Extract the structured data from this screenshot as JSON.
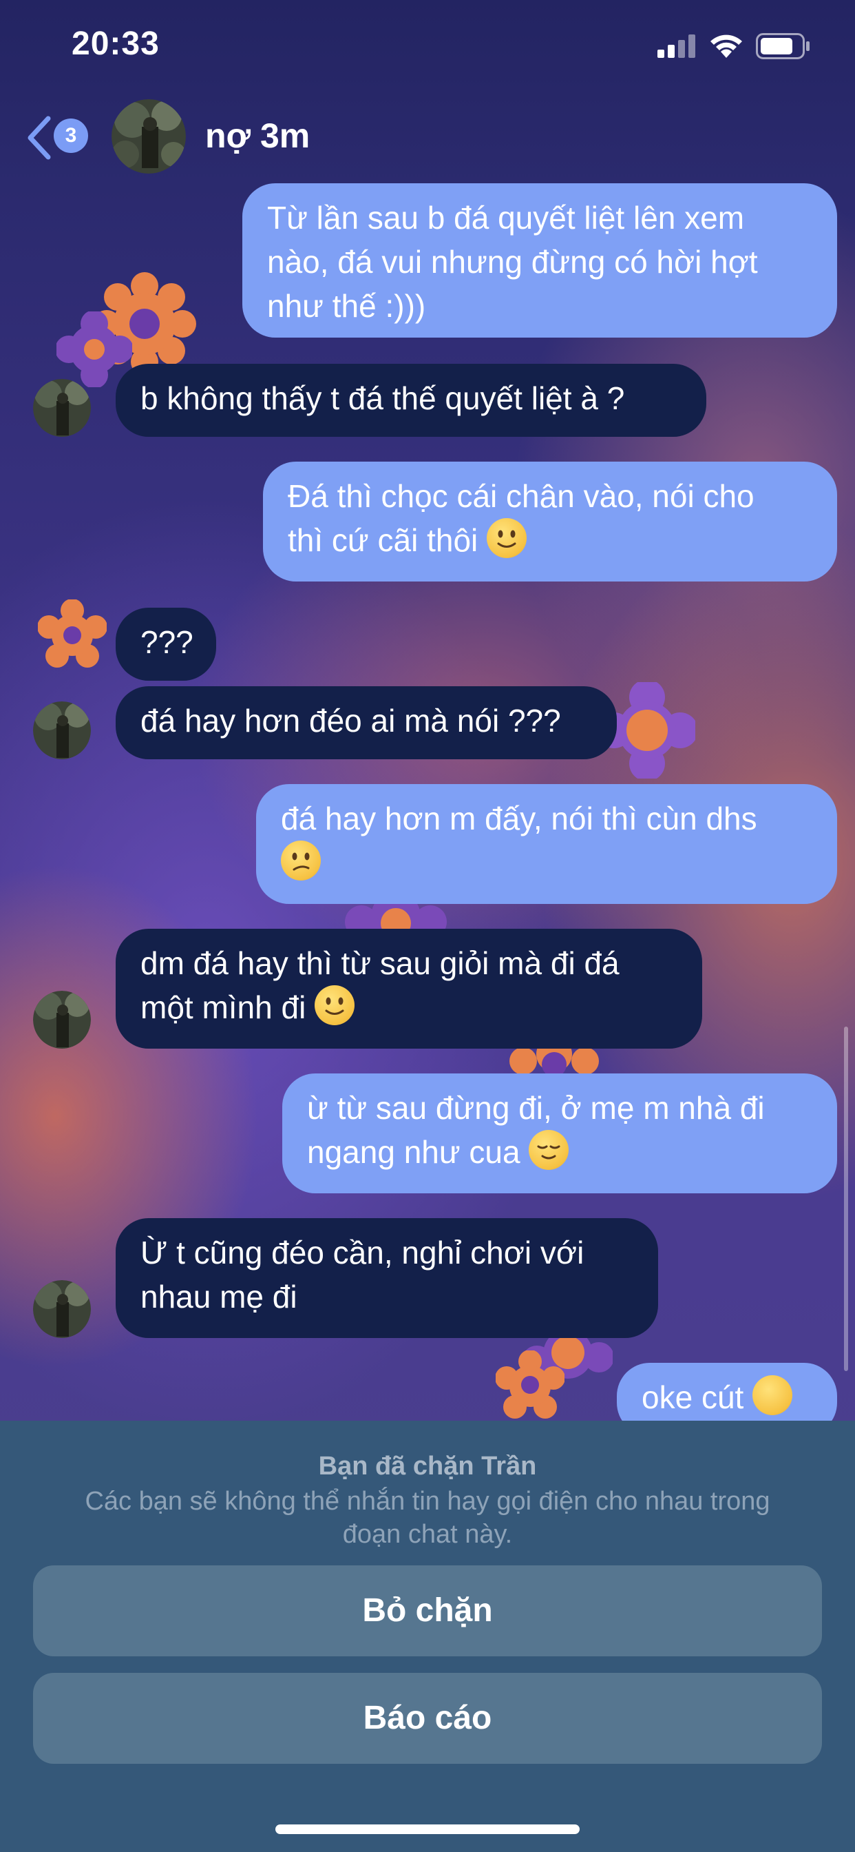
{
  "status_bar": {
    "time": "20:33"
  },
  "header": {
    "back_count": "3",
    "contact_name": "nợ 3m"
  },
  "messages": [
    {
      "id": "m1",
      "side": "sent",
      "lines": [
        "Từ lần sau b đá quyết liệt lên xem",
        "nào, đá vui nhưng đừng có hời hợt",
        "như thế :)))"
      ]
    },
    {
      "id": "m2",
      "side": "received",
      "lines": [
        "b không thấy t đá thế quyết liệt à ?"
      ]
    },
    {
      "id": "m3",
      "side": "sent",
      "lines": [
        "Đá thì chọc cái chân vào, nói cho",
        "thì cứ cãi thôi"
      ],
      "emoji": "slightly-smiling-face-emoji"
    },
    {
      "id": "m4",
      "side": "received",
      "lines": [
        "???"
      ]
    },
    {
      "id": "m5",
      "side": "received",
      "lines": [
        "đá hay hơn đéo ai mà nói ???"
      ]
    },
    {
      "id": "m6",
      "side": "sent",
      "lines": [
        "đá hay hơn m đấy, nói thì cùn dhs"
      ],
      "emoji": "confused-face-emoji"
    },
    {
      "id": "m7",
      "side": "received",
      "lines": [
        "dm đá hay thì từ sau giỏi mà đi đá",
        "một mình đi"
      ],
      "emoji": "slightly-smiling-face-emoji"
    },
    {
      "id": "m8",
      "side": "sent",
      "lines": [
        "ừ từ sau đừng đi, ở mẹ m nhà đi",
        "ngang như cua"
      ],
      "emoji": "relieved-face-emoji"
    },
    {
      "id": "m9",
      "side": "received",
      "lines": [
        "Ừ t cũng đéo cần, nghỉ chơi với",
        "nhau mẹ đi"
      ]
    },
    {
      "id": "m10",
      "side": "sent",
      "lines": [
        "oke cút"
      ],
      "emoji": "ok-hand-emoji"
    }
  ],
  "block_panel": {
    "title": "Bạn đã chặn Trần",
    "description_line1": "Các bạn sẽ không thể nhắn tin hay gọi điện cho nhau trong",
    "description_line2": "đoạn chat này.",
    "unblock_label": "Bỏ chặn",
    "report_label": "Báo cáo"
  },
  "colors": {
    "sent_bubble": "#7fa0f5",
    "received_bubble": "#13204a",
    "panel_bg": "#355879",
    "panel_button": "#567690",
    "badge": "#7b9cf5"
  }
}
